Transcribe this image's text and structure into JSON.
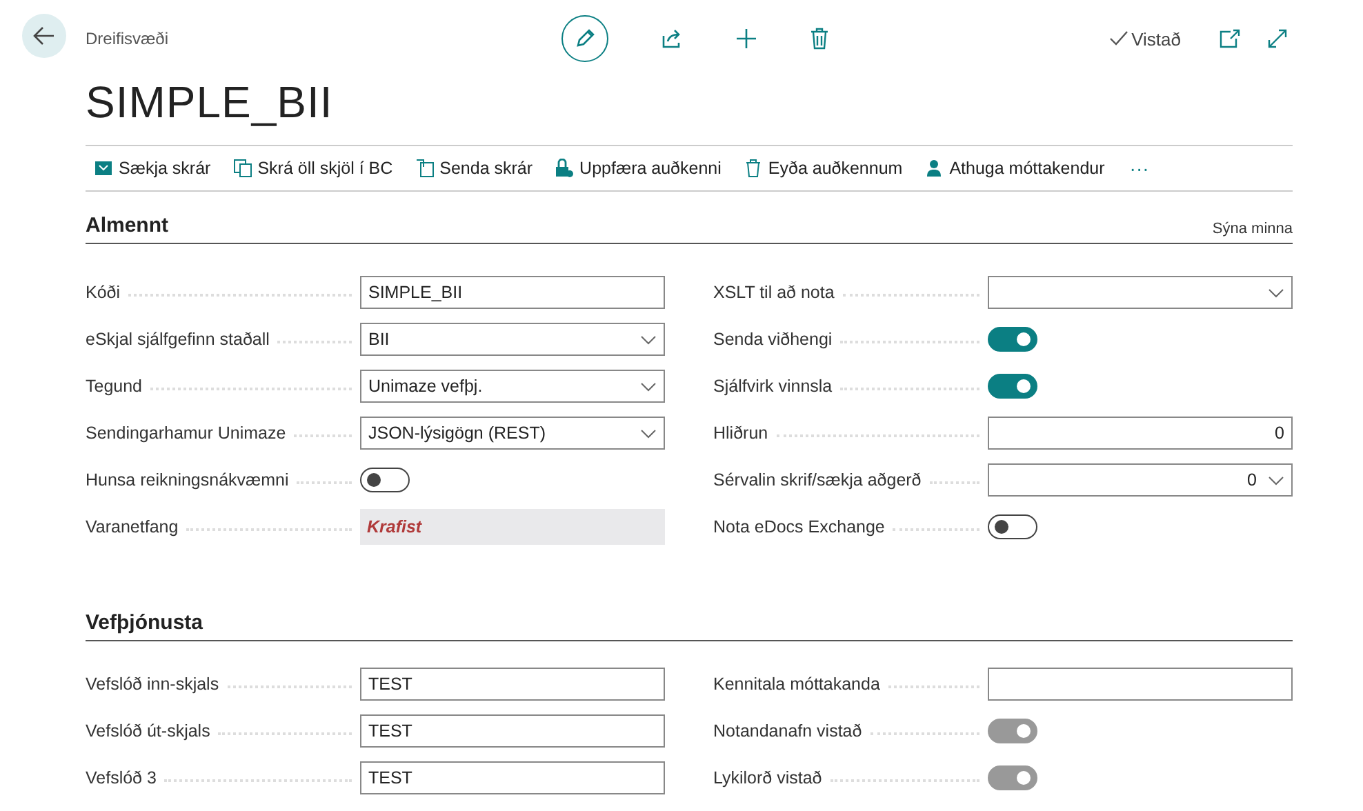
{
  "header": {
    "breadcrumb": "Dreifisvæði",
    "title": "SIMPLE_BII",
    "save_status": "Vistað"
  },
  "actions": [
    {
      "label": "Sækja skrár"
    },
    {
      "label": "Skrá öll skjöl í BC"
    },
    {
      "label": "Senda skrár"
    },
    {
      "label": "Uppfæra auðkenni"
    },
    {
      "label": "Eyða auðkennum"
    },
    {
      "label": "Athuga móttakendur"
    }
  ],
  "more": "···",
  "sections": [
    {
      "title": "Almennt",
      "toggle_link": "Sýna minna",
      "left": [
        {
          "label": "Kóði",
          "kind": "text",
          "value": "SIMPLE_BII"
        },
        {
          "label": "eSkjal sjálfgefinn staðall",
          "kind": "select",
          "value": "BII"
        },
        {
          "label": "Tegund",
          "kind": "select",
          "value": "Unimaze vefþj."
        },
        {
          "label": "Sendingarhamur Unimaze",
          "kind": "select",
          "value": "JSON-lýsigögn (REST)"
        },
        {
          "label": "Hunsa reikningsnákvæmni",
          "kind": "toggle",
          "on": false,
          "disabled": false
        },
        {
          "label": "Varanetfang",
          "kind": "required",
          "value": "Krafist"
        }
      ],
      "right": [
        {
          "label": "XSLT til að nota",
          "kind": "select"
        },
        {
          "label": "Senda viðhengi",
          "kind": "toggle",
          "on": true,
          "disabled": false
        },
        {
          "label": "Sjálfvirk vinnsla",
          "kind": "toggle",
          "on": true,
          "disabled": false
        },
        {
          "label": "Hliðrun",
          "kind": "number",
          "value": "0"
        },
        {
          "label": "Sérvalin skrif/sækja aðgerð",
          "kind": "number-select",
          "value": "0"
        },
        {
          "label": "Nota eDocs Exchange",
          "kind": "toggle",
          "on": false,
          "disabled": false
        }
      ]
    },
    {
      "title": "Vefþjónusta",
      "left": [
        {
          "label": "Vefslóð inn-skjals",
          "kind": "text",
          "value": "TEST"
        },
        {
          "label": "Vefslóð út-skjals",
          "kind": "text",
          "value": "TEST"
        },
        {
          "label": "Vefslóð 3",
          "kind": "text",
          "value": "TEST"
        }
      ],
      "right": [
        {
          "label": "Kennitala móttakanda",
          "kind": "text"
        },
        {
          "label": "Notandanafn vistað",
          "kind": "toggle",
          "on": true,
          "disabled": true
        },
        {
          "label": "Lykilorð vistað",
          "kind": "toggle",
          "on": true,
          "disabled": true
        }
      ]
    }
  ]
}
